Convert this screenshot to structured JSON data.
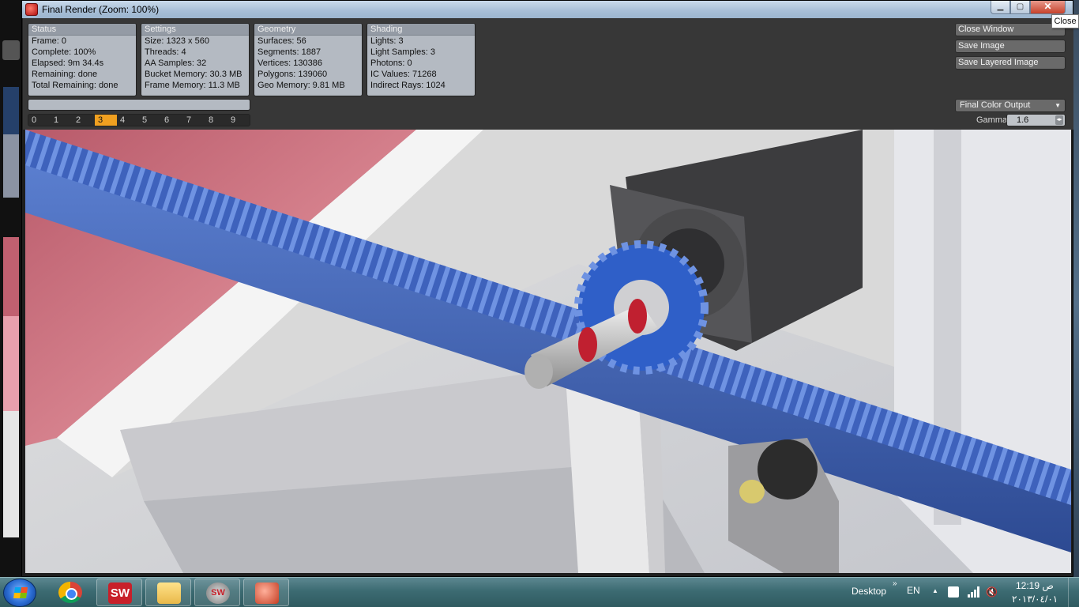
{
  "window": {
    "title": "Final Render (Zoom: 100%)",
    "close_tooltip": "Close",
    "controls": {
      "minimize_icon": "minimize-icon",
      "maximize_icon": "maximize-icon",
      "close_icon": "close-icon"
    }
  },
  "status": {
    "header": "Status",
    "frame": "Frame: 0",
    "complete": "Complete: 100%",
    "elapsed": "Elapsed: 9m 34.4s",
    "remaining": "Remaining: done",
    "total_remaining": "Total Remaining: done"
  },
  "settings": {
    "header": "Settings",
    "size": "Size: 1323 x 560",
    "threads": "Threads: 4",
    "aa_samples": "AA Samples: 32",
    "bucket_memory": "Bucket Memory: 30.3 MB",
    "frame_memory": "Frame Memory: 11.3 MB"
  },
  "geometry": {
    "header": "Geometry",
    "surfaces": "Surfaces: 56",
    "segments": "Segments: 1887",
    "vertices": "Vertices: 130386",
    "polygons": "Polygons: 139060",
    "geo_memory": "Geo Memory: 9.81 MB"
  },
  "shading": {
    "header": "Shading",
    "lights": "Lights: 3",
    "light_samples": "Light Samples: 3",
    "photons": "Photons: 0",
    "ic_values": "IC Values: 71268",
    "indirect_rays": "Indirect Rays: 1024"
  },
  "frames": {
    "labels": [
      "0",
      "1",
      "2",
      "3",
      "4",
      "5",
      "6",
      "7",
      "8",
      "9"
    ],
    "active_index": 3,
    "active_color": "#f0a020"
  },
  "actions": {
    "close_window": "Close Window",
    "save_image": "Save Image",
    "save_layered_image": "Save Layered Image"
  },
  "output": {
    "selected": "Final Color Output",
    "gamma_label": "Gamma",
    "gamma_value": "1.6"
  },
  "taskbar": {
    "apps": [
      "start-orb",
      "chrome-icon",
      "solidworks-icon",
      "explorer-icon",
      "solidworks-render-icon",
      "render-window-icon"
    ],
    "desktop_label": "Desktop",
    "desktop_chevron": "»",
    "language": "EN",
    "clock_time": "12:19 ص",
    "clock_date": "٢٠١٣/٠٤/٠١"
  },
  "colors": {
    "rack_blue": "#3a5db0",
    "pinion_blue": "#2f5fc8",
    "motor_dark": "#3a3a3a",
    "accent_orange": "#f0a020"
  }
}
